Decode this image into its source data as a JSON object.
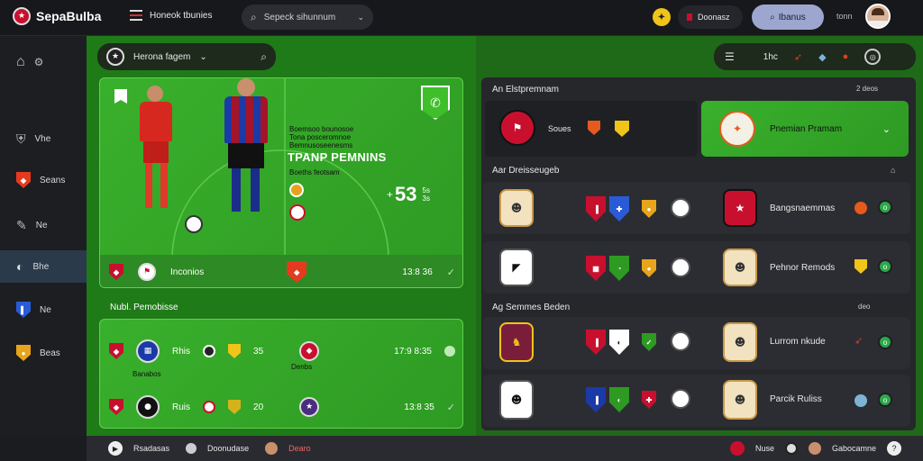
{
  "app": {
    "name": "SepaBulba"
  },
  "topbar": {
    "nav_label": "Honeok tbunies",
    "search_placeholder": "Sepeck sihunnum",
    "account_label": "Doonasz",
    "primary_button": "Ibanus",
    "user_label": "tonn"
  },
  "toolbar": {
    "title": "Herona fagem",
    "count": "1hc"
  },
  "sidebar": {
    "items": [
      {
        "label": "Vhe"
      },
      {
        "label": "Seans"
      },
      {
        "label": "Ne"
      },
      {
        "label": "Bhe"
      },
      {
        "label": "Ne"
      },
      {
        "label": "Beas"
      }
    ]
  },
  "hero": {
    "subtitle_lines": [
      "Boemsoo bounosoe",
      "Tona posceromnoe",
      "Bemnusoseenesms"
    ],
    "title": "TPANP PEMNINS",
    "subtitle_lines_2": [
      "Boeths feotsam"
    ],
    "score": "53",
    "score_prefix": "+",
    "score_suffix": "5s\n3s",
    "team_label": "Inconios",
    "time": "13:8 36"
  },
  "section_left": {
    "title": "Nubl. Pemobisse",
    "rows": [
      {
        "name": "Rhis",
        "count": "35",
        "sub": "Banabos",
        "time": "17:9 8:35",
        "sub2": "Denbs"
      },
      {
        "name": "Ruis",
        "count": "20",
        "time": "13:8 35"
      }
    ]
  },
  "section_right_top": {
    "title": "An Elstpremnam",
    "count": "2 deos",
    "row": {
      "label": "Soues",
      "featured": "Pnemian Pramam"
    }
  },
  "section_right_mid": {
    "title": "Aar Dreisseugeb",
    "rows": [
      {
        "label": "Bangsnaemmas"
      },
      {
        "label": "Pehnor Remods"
      }
    ]
  },
  "section_right_bottom": {
    "title": "Ag Semmes Beden",
    "count": "deo",
    "rows": [
      {
        "label": "Lurrom nkude"
      },
      {
        "label": "Parcik Ruliss"
      }
    ]
  },
  "bottombar": {
    "items": [
      "Rsadasas",
      "Doonudase",
      "Dearo"
    ],
    "right": [
      "Nuse",
      "Gabocamne"
    ]
  },
  "colors": {
    "accent": "#2e9a23",
    "danger": "#c8102e"
  }
}
